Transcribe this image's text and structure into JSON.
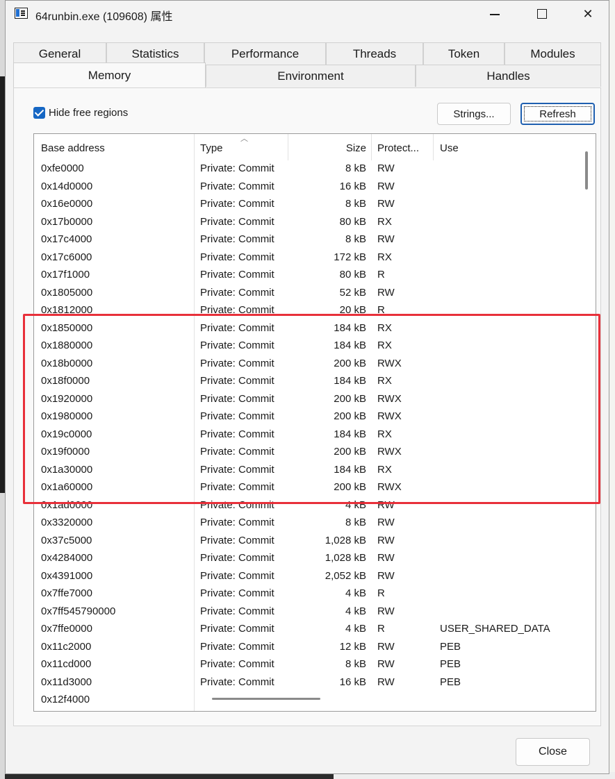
{
  "window": {
    "title": "64runbin.exe (109608) 属性",
    "controls": {
      "minimize": "minimize-icon",
      "maximize": "maximize-icon",
      "close": "close-icon"
    }
  },
  "tabs": {
    "row1": [
      "General",
      "Statistics",
      "Performance",
      "Threads",
      "Token",
      "Modules"
    ],
    "row2": [
      "Memory",
      "Environment",
      "Handles"
    ],
    "active": "Memory"
  },
  "memory": {
    "hide_free_label": "Hide free regions",
    "hide_free_checked": true,
    "strings_button": "Strings...",
    "refresh_button": "Refresh",
    "columns": [
      "Base address",
      "Type",
      "Size",
      "Protect...",
      "Use"
    ],
    "rows": [
      [
        "0xfe0000",
        "Private: Commit",
        "8 kB",
        "RW",
        ""
      ],
      [
        "0x14d0000",
        "Private: Commit",
        "16 kB",
        "RW",
        ""
      ],
      [
        "0x16e0000",
        "Private: Commit",
        "8 kB",
        "RW",
        ""
      ],
      [
        "0x17b0000",
        "Private: Commit",
        "80 kB",
        "RX",
        ""
      ],
      [
        "0x17c4000",
        "Private: Commit",
        "8 kB",
        "RW",
        ""
      ],
      [
        "0x17c6000",
        "Private: Commit",
        "172 kB",
        "RX",
        ""
      ],
      [
        "0x17f1000",
        "Private: Commit",
        "80 kB",
        "R",
        ""
      ],
      [
        "0x1805000",
        "Private: Commit",
        "52 kB",
        "RW",
        ""
      ],
      [
        "0x1812000",
        "Private: Commit",
        "20 kB",
        "R",
        ""
      ],
      [
        "0x1850000",
        "Private: Commit",
        "184 kB",
        "RX",
        ""
      ],
      [
        "0x1880000",
        "Private: Commit",
        "184 kB",
        "RX",
        ""
      ],
      [
        "0x18b0000",
        "Private: Commit",
        "200 kB",
        "RWX",
        ""
      ],
      [
        "0x18f0000",
        "Private: Commit",
        "184 kB",
        "RX",
        ""
      ],
      [
        "0x1920000",
        "Private: Commit",
        "200 kB",
        "RWX",
        ""
      ],
      [
        "0x1980000",
        "Private: Commit",
        "200 kB",
        "RWX",
        ""
      ],
      [
        "0x19c0000",
        "Private: Commit",
        "184 kB",
        "RX",
        ""
      ],
      [
        "0x19f0000",
        "Private: Commit",
        "200 kB",
        "RWX",
        ""
      ],
      [
        "0x1a30000",
        "Private: Commit",
        "184 kB",
        "RX",
        ""
      ],
      [
        "0x1a60000",
        "Private: Commit",
        "200 kB",
        "RWX",
        ""
      ],
      [
        "0x1ad0000",
        "Private: Commit",
        "4 kB",
        "RW",
        ""
      ],
      [
        "0x3320000",
        "Private: Commit",
        "8 kB",
        "RW",
        ""
      ],
      [
        "0x37c5000",
        "Private: Commit",
        "1,028 kB",
        "RW",
        ""
      ],
      [
        "0x4284000",
        "Private: Commit",
        "1,028 kB",
        "RW",
        ""
      ],
      [
        "0x4391000",
        "Private: Commit",
        "2,052 kB",
        "RW",
        ""
      ],
      [
        "0x7ffe7000",
        "Private: Commit",
        "4 kB",
        "R",
        ""
      ],
      [
        "0x7ff545790000",
        "Private: Commit",
        "4 kB",
        "RW",
        ""
      ],
      [
        "0x7ffe0000",
        "Private: Commit",
        "4 kB",
        "R",
        "USER_SHARED_DATA"
      ],
      [
        "0x11c2000",
        "Private: Commit",
        "12 kB",
        "RW",
        "PEB"
      ],
      [
        "0x11cd000",
        "Private: Commit",
        "8 kB",
        "RW",
        "PEB"
      ],
      [
        "0x11d3000",
        "Private: Commit",
        "16 kB",
        "RW",
        "PEB"
      ],
      [
        "0x12f4000",
        "",
        "",
        "",
        ""
      ]
    ]
  },
  "footer": {
    "close_button": "Close"
  },
  "colors": {
    "highlight": "#e8303a",
    "accent": "#1667c4"
  }
}
